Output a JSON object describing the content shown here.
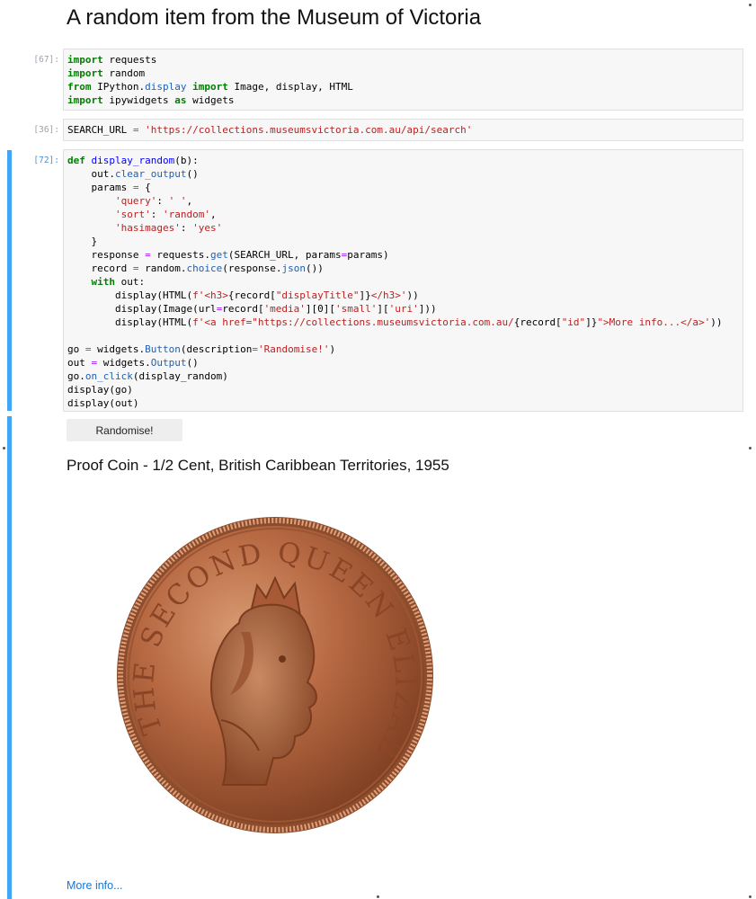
{
  "notebook": {
    "title": "A random item from the Museum of Victoria"
  },
  "cells": [
    {
      "prompt": "[67]:",
      "lines": [
        [
          [
            "kw",
            "import"
          ],
          [
            "t",
            " requests"
          ]
        ],
        [
          [
            "kw",
            "import"
          ],
          [
            "t",
            " random"
          ]
        ],
        [
          [
            "kw",
            "from"
          ],
          [
            "t",
            " IPython."
          ],
          [
            "attr",
            "display"
          ],
          [
            "t",
            " "
          ],
          [
            "kw",
            "import"
          ],
          [
            "t",
            " Image, display, HTML"
          ]
        ],
        [
          [
            "kw",
            "import"
          ],
          [
            "t",
            " ipywidgets "
          ],
          [
            "kw",
            "as"
          ],
          [
            "t",
            " widgets"
          ]
        ]
      ]
    },
    {
      "prompt": "[36]:",
      "lines": [
        [
          [
            "t",
            "SEARCH_URL "
          ],
          [
            "op",
            "="
          ],
          [
            "t",
            " "
          ],
          [
            "str",
            "'https://collections.museumsvictoria.com.au/api/search'"
          ]
        ]
      ]
    },
    {
      "prompt": "[72]:",
      "lines": [
        [
          [
            "kw",
            "def"
          ],
          [
            "t",
            " "
          ],
          [
            "fn",
            "display_random"
          ],
          [
            "t",
            "(b):"
          ]
        ],
        [
          [
            "t",
            "    out."
          ],
          [
            "attr",
            "clear_output"
          ],
          [
            "t",
            "()"
          ]
        ],
        [
          [
            "t",
            "    params "
          ],
          [
            "op",
            "="
          ],
          [
            "t",
            " {"
          ]
        ],
        [
          [
            "t",
            "        "
          ],
          [
            "str",
            "'query'"
          ],
          [
            "t",
            ": "
          ],
          [
            "str",
            "' '"
          ],
          [
            "t",
            ","
          ]
        ],
        [
          [
            "t",
            "        "
          ],
          [
            "str",
            "'sort'"
          ],
          [
            "t",
            ": "
          ],
          [
            "str",
            "'random'"
          ],
          [
            "t",
            ","
          ]
        ],
        [
          [
            "t",
            "        "
          ],
          [
            "str",
            "'hasimages'"
          ],
          [
            "t",
            ": "
          ],
          [
            "str",
            "'yes'"
          ]
        ],
        [
          [
            "t",
            "    }"
          ]
        ],
        [
          [
            "t",
            "    response "
          ],
          [
            "op",
            "="
          ],
          [
            "t",
            " requests."
          ],
          [
            "attr",
            "get"
          ],
          [
            "t",
            "(SEARCH_URL, params"
          ],
          [
            "op",
            "="
          ],
          [
            "t",
            "params)"
          ]
        ],
        [
          [
            "t",
            "    record "
          ],
          [
            "op",
            "="
          ],
          [
            "t",
            " random."
          ],
          [
            "attr",
            "choice"
          ],
          [
            "t",
            "(response."
          ],
          [
            "attr",
            "json"
          ],
          [
            "t",
            "())"
          ]
        ],
        [
          [
            "t",
            "    "
          ],
          [
            "kw",
            "with"
          ],
          [
            "t",
            " out:"
          ]
        ],
        [
          [
            "t",
            "        display(HTML("
          ],
          [
            "str",
            "f'<h3>"
          ],
          [
            "t",
            "{record["
          ],
          [
            "str",
            "\"displayTitle\""
          ],
          [
            "t",
            "]}"
          ],
          [
            "str",
            "</h3>'"
          ],
          [
            "t",
            "))"
          ]
        ],
        [
          [
            "t",
            "        display(Image(url"
          ],
          [
            "op",
            "="
          ],
          [
            "t",
            "record["
          ],
          [
            "str",
            "'media'"
          ],
          [
            "t",
            "][0]["
          ],
          [
            "str",
            "'small'"
          ],
          [
            "t",
            "]["
          ],
          [
            "str",
            "'uri'"
          ],
          [
            "t",
            "]))"
          ]
        ],
        [
          [
            "t",
            "        display(HTML("
          ],
          [
            "str",
            "f'<a href=\"https://collections.museumsvictoria.com.au/"
          ],
          [
            "t",
            "{record["
          ],
          [
            "str",
            "\"id\""
          ],
          [
            "t",
            "]}"
          ],
          [
            "str",
            "\">More info...</a>'"
          ],
          [
            "t",
            "))"
          ]
        ],
        [
          [
            "t",
            ""
          ]
        ],
        [
          [
            "t",
            "go "
          ],
          [
            "op",
            "="
          ],
          [
            "t",
            " widgets."
          ],
          [
            "attr",
            "Button"
          ],
          [
            "t",
            "(description"
          ],
          [
            "op",
            "="
          ],
          [
            "str",
            "'Randomise!'"
          ],
          [
            "t",
            ")"
          ]
        ],
        [
          [
            "t",
            "out "
          ],
          [
            "op",
            "="
          ],
          [
            "t",
            " widgets."
          ],
          [
            "attr",
            "Output"
          ],
          [
            "t",
            "()"
          ]
        ],
        [
          [
            "t",
            "go."
          ],
          [
            "attr",
            "on_click"
          ],
          [
            "t",
            "(display_random)"
          ]
        ],
        [
          [
            "t",
            "display(go)"
          ]
        ],
        [
          [
            "t",
            "display(out)"
          ]
        ]
      ]
    }
  ],
  "output": {
    "button_label": "Randomise!",
    "record_title": "Proof Coin - 1/2 Cent, British Caribbean Territories, 1955",
    "coin_inscription": "THE SECOND QUEEN ELIZABETH",
    "link_text": "More info..."
  },
  "colors": {
    "accent_bar": "#42a5f5",
    "link": "#1976d2",
    "coin_copper": "#b0643e"
  },
  "icons": {
    "coin_image": "coin-image"
  }
}
